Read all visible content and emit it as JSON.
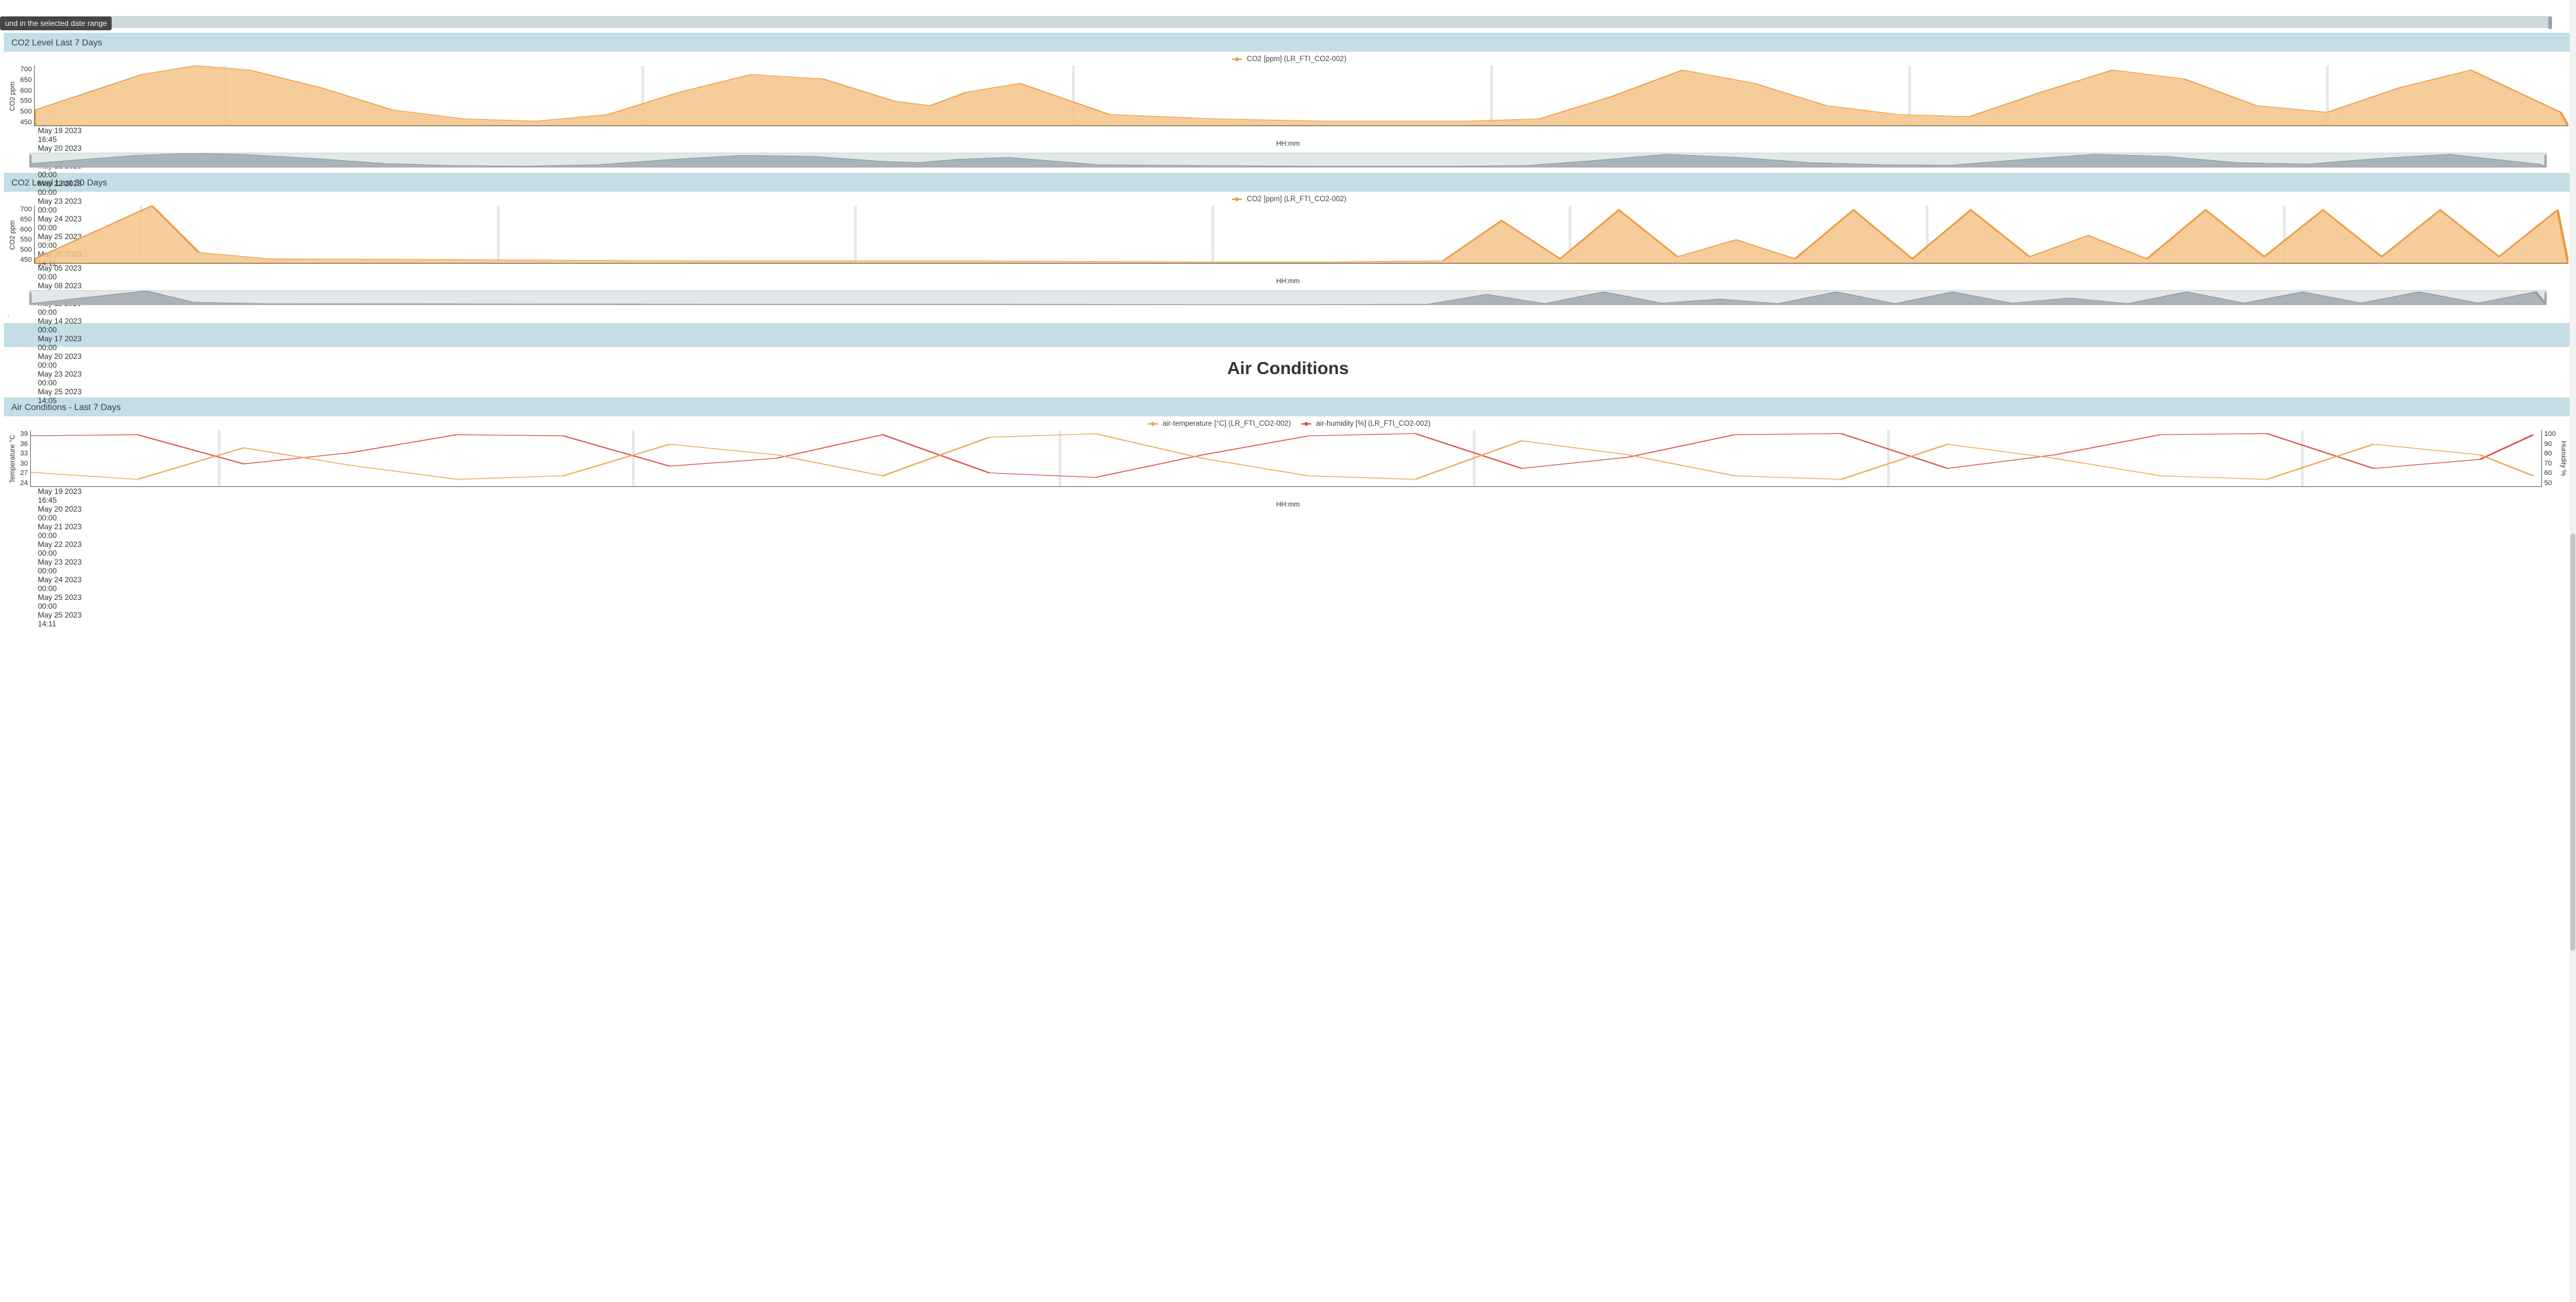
{
  "tooltip": "und in the selected date range",
  "panels": {
    "co2_7d": {
      "title": "CO2 Level Last 7 Days",
      "legend": "CO2 [ppm] (LR_FTI_CO2-002)",
      "ylabel": "CO2 ppm",
      "xlabel": "HH:mm",
      "yticks": [
        "700",
        "650",
        "600",
        "550",
        "500",
        "450"
      ],
      "xticks": [
        {
          "pos": 0.0,
          "l1": "May 19 2023",
          "l2": "16:45"
        },
        {
          "pos": 0.075,
          "l1": "May 20 2023",
          "l2": "00:00"
        },
        {
          "pos": 0.24,
          "l1": "May 21 2023",
          "l2": "00:00"
        },
        {
          "pos": 0.41,
          "l1": "May 22 2023",
          "l2": "00:00"
        },
        {
          "pos": 0.575,
          "l1": "May 23 2023",
          "l2": "00:00"
        },
        {
          "pos": 0.74,
          "l1": "May 24 2023",
          "l2": "00:00"
        },
        {
          "pos": 0.905,
          "l1": "May 25 2023",
          "l2": "00:00"
        },
        {
          "pos": 1.0,
          "l1": "May 25 2023",
          "l2": "14:11"
        }
      ]
    },
    "co2_30d": {
      "title": "CO2 Level Last 30 Days",
      "legend": "CO2 [ppm] (LR_FTI_CO2-002)",
      "ylabel": "CO2 ppm",
      "xlabel": "HH:mm",
      "yticks": [
        "700",
        "650",
        "600",
        "550",
        "500",
        "450"
      ],
      "xticks": [
        {
          "pos": 0.042,
          "l1": "May 05 2023",
          "l2": "00:00"
        },
        {
          "pos": 0.183,
          "l1": "May 08 2023",
          "l2": "00:00"
        },
        {
          "pos": 0.324,
          "l1": "May 11 2023",
          "l2": "00:00"
        },
        {
          "pos": 0.465,
          "l1": "May 14 2023",
          "l2": "00:00"
        },
        {
          "pos": 0.606,
          "l1": "May 17 2023",
          "l2": "00:00"
        },
        {
          "pos": 0.747,
          "l1": "May 20 2023",
          "l2": "00:00"
        },
        {
          "pos": 0.888,
          "l1": "May 23 2023",
          "l2": "00:00"
        },
        {
          "pos": 1.0,
          "l1": "May 25 2023",
          "l2": "14:05"
        }
      ]
    },
    "air_7d": {
      "title": "Air Conditions - Last 7 Days",
      "legend_temp": "air-temperature [°C] (LR_FTI_CO2-002)",
      "legend_hum": "air-humidity [%] (LR_FTI_CO2-002)",
      "ylabel_left": "Temperature °C",
      "ylabel_right": "Humidity %",
      "xlabel": "HH:mm",
      "yticks_left": [
        "39",
        "36",
        "33",
        "30",
        "27",
        "24"
      ],
      "yticks_right": [
        "100",
        "90",
        "80",
        "70",
        "60",
        "50"
      ],
      "xticks": [
        {
          "pos": 0.0,
          "l1": "May 19 2023",
          "l2": "16:45"
        },
        {
          "pos": 0.075,
          "l1": "May 20 2023",
          "l2": "00:00"
        },
        {
          "pos": 0.24,
          "l1": "May 21 2023",
          "l2": "00:00"
        },
        {
          "pos": 0.41,
          "l1": "May 22 2023",
          "l2": "00:00"
        },
        {
          "pos": 0.575,
          "l1": "May 23 2023",
          "l2": "00:00"
        },
        {
          "pos": 0.74,
          "l1": "May 24 2023",
          "l2": "00:00"
        },
        {
          "pos": 0.905,
          "l1": "May 25 2023",
          "l2": "00:00"
        },
        {
          "pos": 1.0,
          "l1": "May 25 2023",
          "l2": "14:11"
        }
      ]
    }
  },
  "section_title": "Air Conditions",
  "colors": {
    "area": "#f6c38a",
    "area_stroke": "#ea9a3e",
    "hum": "#e04848",
    "temp": "#eba54a",
    "header": "#c5dee5"
  },
  "chart_data": [
    {
      "id": "co2_7d",
      "type": "area",
      "title": "CO2 Level Last 7 Days",
      "ylabel": "CO2 ppm",
      "ylim": [
        450,
        720
      ],
      "x_unit": "hours since May 19 2023 16:45",
      "x_range": [
        0,
        141.43
      ],
      "series": [
        {
          "name": "CO2 [ppm] (LR_FTI_CO2-002)",
          "x": [
            0,
            3,
            6,
            9,
            12,
            16,
            20,
            24,
            28,
            32,
            36,
            40,
            44,
            48,
            50,
            52,
            55,
            60,
            66,
            72,
            76,
            80,
            84,
            88,
            92,
            96,
            100,
            104,
            108,
            112,
            116,
            120,
            124,
            128,
            132,
            136,
            141
          ],
          "values": [
            520,
            600,
            680,
            720,
            700,
            620,
            520,
            480,
            470,
            500,
            600,
            680,
            660,
            560,
            540,
            600,
            640,
            500,
            480,
            470,
            470,
            470,
            480,
            580,
            700,
            640,
            540,
            500,
            490,
            600,
            700,
            660,
            540,
            510,
            620,
            700,
            510
          ]
        }
      ]
    },
    {
      "id": "co2_30d",
      "type": "area",
      "title": "CO2 Level Last 30 Days",
      "ylabel": "CO2 ppm",
      "ylim": [
        450,
        720
      ],
      "x_unit": "days since May 04 2023 00:00",
      "x_range": [
        0,
        21.59
      ],
      "series": [
        {
          "name": "CO2 [ppm] (LR_FTI_CO2-002)",
          "x": [
            0,
            0.6,
            1.0,
            1.4,
            2,
            4,
            6,
            8,
            10,
            11,
            12,
            12.5,
            13,
            13.5,
            14,
            14.5,
            15,
            15.5,
            16,
            16.5,
            17,
            17.5,
            18,
            18.5,
            19,
            19.5,
            20,
            20.5,
            21,
            21.5
          ],
          "values": [
            470,
            620,
            720,
            500,
            470,
            465,
            460,
            460,
            455,
            455,
            460,
            650,
            470,
            700,
            480,
            560,
            470,
            700,
            470,
            700,
            480,
            580,
            470,
            700,
            480,
            700,
            480,
            700,
            480,
            700
          ]
        }
      ]
    },
    {
      "id": "air_7d",
      "type": "line",
      "title": "Air Conditions - Last 7 Days",
      "ylabel_left": "Temperature °C",
      "ylim_left": [
        24,
        40
      ],
      "ylabel_right": "Humidity %",
      "ylim_right": [
        50,
        100
      ],
      "x_unit": "hours since May 19 2023 16:45",
      "x_range": [
        0,
        141.43
      ],
      "series": [
        {
          "name": "air-temperature [°C]",
          "axis": "left",
          "x": [
            0,
            6,
            12,
            18,
            24,
            30,
            36,
            42,
            48,
            54,
            60,
            66,
            72,
            78,
            84,
            90,
            96,
            102,
            108,
            114,
            120,
            126,
            132,
            138,
            141
          ],
          "values": [
            28,
            26,
            35,
            30,
            26,
            27,
            36,
            33,
            27,
            38,
            39,
            32,
            27,
            26,
            37,
            33,
            27,
            26,
            36,
            32,
            27,
            26,
            36,
            33,
            27
          ]
        },
        {
          "name": "air-humidity [%]",
          "axis": "right",
          "x": [
            0,
            6,
            12,
            18,
            24,
            30,
            36,
            42,
            48,
            54,
            60,
            66,
            72,
            78,
            84,
            90,
            96,
            102,
            108,
            114,
            120,
            126,
            132,
            138,
            141
          ],
          "values": [
            95,
            96,
            70,
            80,
            96,
            95,
            68,
            75,
            96,
            62,
            58,
            78,
            95,
            97,
            66,
            76,
            96,
            97,
            66,
            78,
            96,
            97,
            66,
            74,
            96
          ]
        }
      ]
    }
  ]
}
